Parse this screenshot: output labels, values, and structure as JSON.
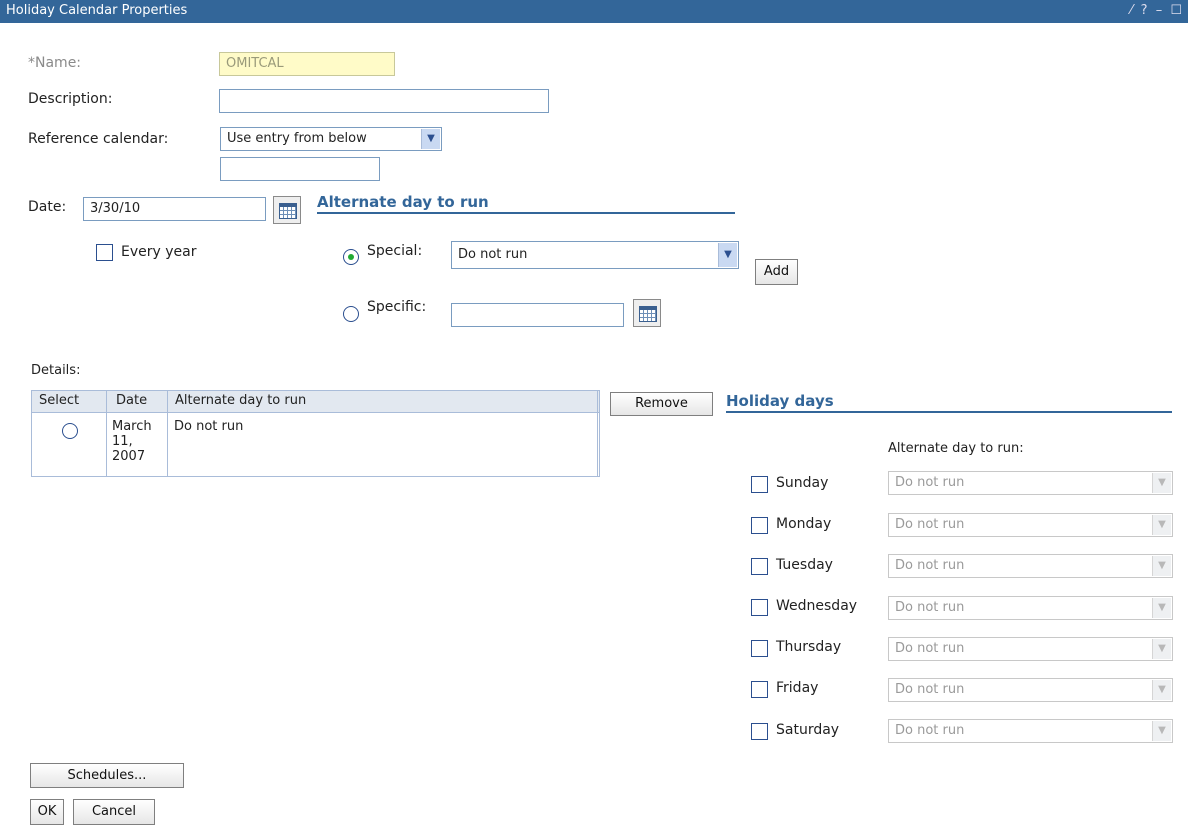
{
  "window": {
    "title": "Holiday Calendar Properties",
    "controls": "⁄ ? – ☐"
  },
  "form": {
    "name_label": "*Name:",
    "name_value": "OMITCAL",
    "description_label": "Description:",
    "description_value": "",
    "reference_label": "Reference calendar:",
    "reference_value": "Use entry from below",
    "reference_extra_value": "",
    "date_label": "Date:",
    "date_value": "3/30/10",
    "every_year_label": "Every year"
  },
  "alternate": {
    "title": "Alternate day to run",
    "special_label": "Special:",
    "special_value": "Do not run",
    "specific_label": "Specific:",
    "specific_value": "",
    "add_label": "Add"
  },
  "details": {
    "label": "Details:",
    "columns": [
      "Select",
      "Date",
      "Alternate day to run"
    ],
    "rows": [
      {
        "date_lines": [
          "March",
          "11,",
          "2007"
        ],
        "alt": "Do not run"
      }
    ],
    "remove_label": "Remove"
  },
  "holiday_days": {
    "title": "Holiday days",
    "alt_header": "Alternate day to run:",
    "days": [
      {
        "label": "Sunday",
        "value": "Do not run"
      },
      {
        "label": "Monday",
        "value": "Do not run"
      },
      {
        "label": "Tuesday",
        "value": "Do not run"
      },
      {
        "label": "Wednesday",
        "value": "Do not run"
      },
      {
        "label": "Thursday",
        "value": "Do not run"
      },
      {
        "label": "Friday",
        "value": "Do not run"
      },
      {
        "label": "Saturday",
        "value": "Do not run"
      }
    ]
  },
  "footer": {
    "schedules_label": "Schedules...",
    "ok_label": "OK",
    "cancel_label": "Cancel"
  }
}
